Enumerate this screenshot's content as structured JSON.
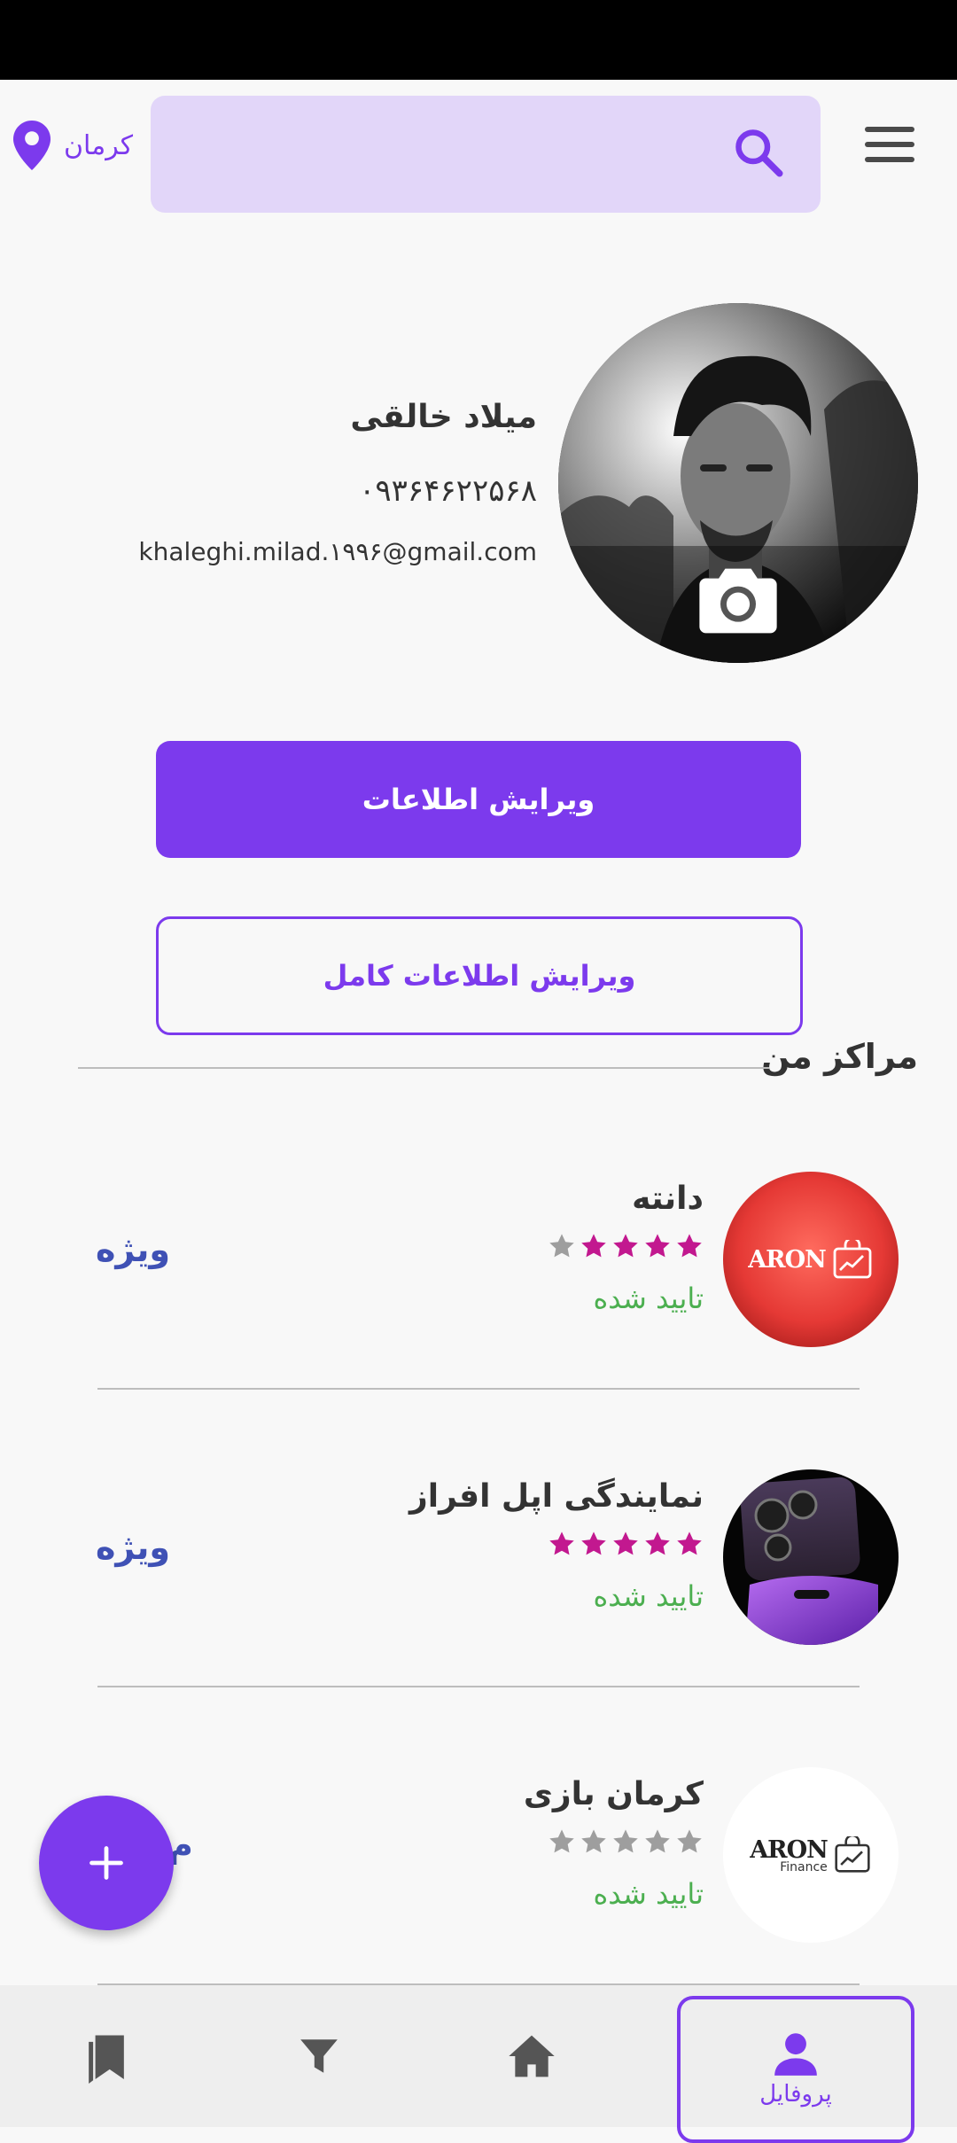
{
  "header": {
    "location": "کرمان",
    "search_placeholder": ""
  },
  "profile": {
    "name": "میلاد خالقی",
    "phone": "۰۹۳۶۴۶۲۲۵۶۸",
    "email": "khaleghi.milad.۱۹۹۶@gmail.com"
  },
  "actions": {
    "edit_info": "ویرایش اطلاعات",
    "edit_full_info": "ویرایش اطلاعات کامل"
  },
  "centers_section": {
    "title": "مراکز من",
    "items": [
      {
        "name": "دانته",
        "rating": 4,
        "status": "تایید شده",
        "badge": "ویژه",
        "logo_text": "ARON",
        "logo_subtext": ""
      },
      {
        "name": "نمایندگی اپل افراز",
        "rating": 5,
        "status": "تایید شده",
        "badge": "ویژه",
        "logo_text": "",
        "logo_subtext": ""
      },
      {
        "name": "کرمان بازی",
        "rating": 0,
        "status": "تایید شده",
        "badge": "م",
        "logo_text": "ARON",
        "logo_subtext": "Finance"
      }
    ]
  },
  "bottom_nav": {
    "profile_label": "پروفایل"
  },
  "colors": {
    "primary": "#7c3aed",
    "search_bg": "#e2d6f9",
    "star_active": "#c2188f",
    "star_inactive": "#9e9e9e",
    "status_green": "#4caf50",
    "badge_blue": "#3f51b5"
  }
}
